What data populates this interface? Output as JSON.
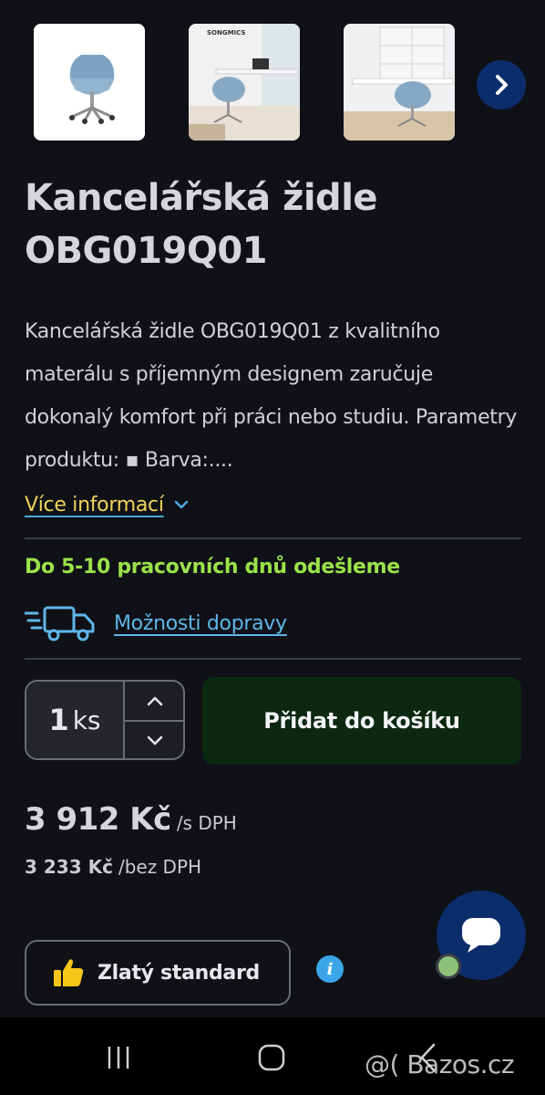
{
  "product": {
    "title_line1": "Kancelářská židle",
    "title_line2": "OBG019Q01",
    "description": "Kancelářská židle OBG019Q01 z kvalitního materálu s příjemným designem zaručuje dokonalý komfort při práci nebo studiu. Parametry produktu: ▪ Barva:....",
    "more_info_label": "Více informací",
    "shipping_note": "Do 5-10 pracovních dnů odešleme",
    "transport_label": "Možnosti dopravy"
  },
  "gallery": {
    "thumb2_brand": "SONGMICS",
    "icons": {
      "next": "chevron-right-icon"
    }
  },
  "cart": {
    "quantity": "1",
    "unit": "ks",
    "add_button_label": "Přidat do košíku"
  },
  "price": {
    "with_vat": "3 912 Kč",
    "with_vat_label": "/s DPH",
    "without_vat": "3 233 Kč",
    "without_vat_label": "/bez DPH"
  },
  "badge": {
    "standard_label": "Zlatý standard"
  },
  "watermark": "@( Bazos.cz",
  "colors": {
    "background": "#0f1117",
    "accent_blue": "#0c2d6b",
    "shipping_green": "#9be24a",
    "link_blue": "#5fb6e8",
    "more_info_yellow": "#f0d35a",
    "add_button_bg": "#0b2811"
  }
}
